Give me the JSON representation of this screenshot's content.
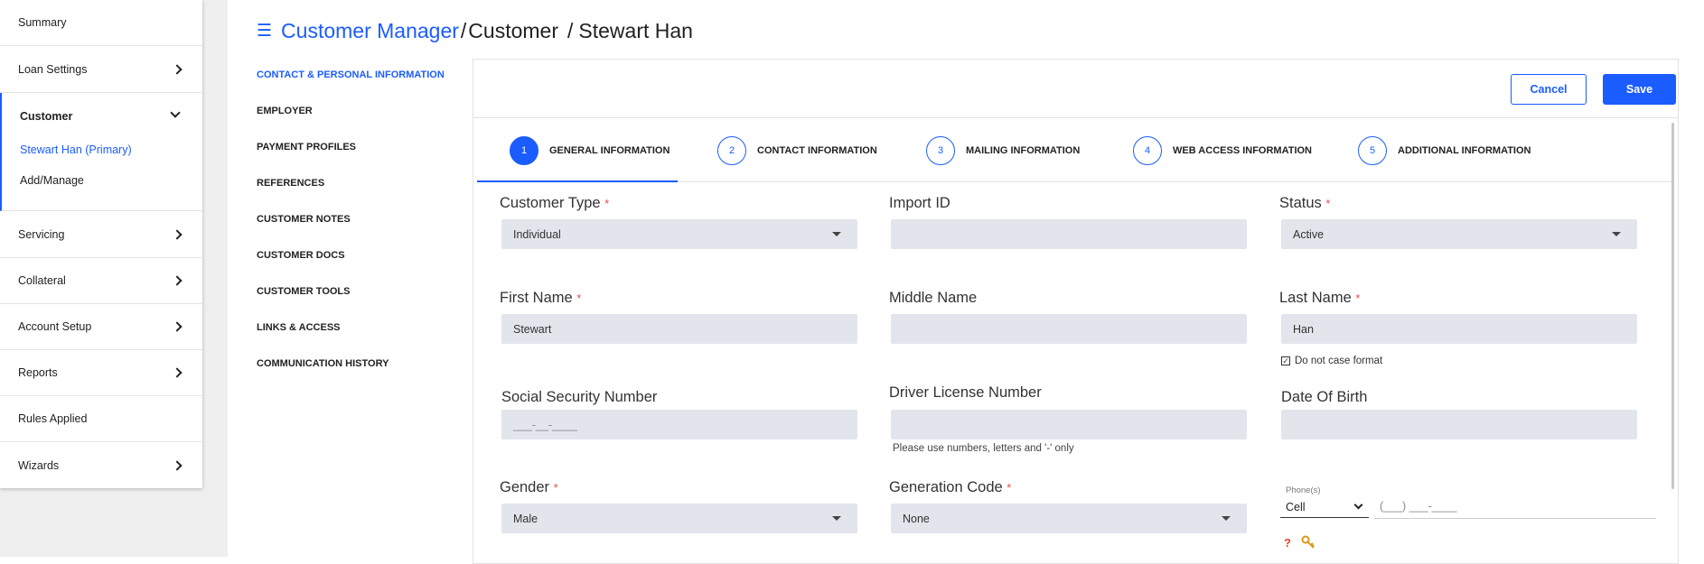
{
  "sidebar": {
    "items": {
      "summary": "Summary",
      "loan_settings": "Loan Settings",
      "customer": "Customer",
      "customer_primary": "Stewart Han (Primary)",
      "customer_add_manage": "Add/Manage",
      "servicing": "Servicing",
      "collateral": "Collateral",
      "account_setup": "Account Setup",
      "reports": "Reports",
      "rules_applied": "Rules Applied",
      "wizards": "Wizards"
    }
  },
  "header": {
    "menu_icon": "hamburger-icon",
    "breadcrumb_root": "Customer Manager",
    "separator": "/",
    "breadcrumb_mid": "Customer",
    "breadcrumb_current": "Stewart Han"
  },
  "subnav": [
    "CONTACT & PERSONAL INFORMATION",
    "EMPLOYER",
    "PAYMENT PROFILES",
    "REFERENCES",
    "CUSTOMER NOTES",
    "CUSTOMER DOCS",
    "CUSTOMER TOOLS",
    "LINKS & ACCESS",
    "COMMUNICATION HISTORY"
  ],
  "actions": {
    "cancel": "Cancel",
    "save": "Save"
  },
  "steps": [
    {
      "num": "1",
      "label": "GENERAL INFORMATION"
    },
    {
      "num": "2",
      "label": "CONTACT INFORMATION"
    },
    {
      "num": "3",
      "label": "MAILING INFORMATION"
    },
    {
      "num": "4",
      "label": "WEB ACCESS INFORMATION"
    },
    {
      "num": "5",
      "label": "ADDITIONAL INFORMATION"
    }
  ],
  "form": {
    "customer_type": {
      "label": "Customer Type",
      "value": "Individual"
    },
    "import_id": {
      "label": "Import ID",
      "value": ""
    },
    "status": {
      "label": "Status",
      "value": "Active"
    },
    "first_name": {
      "label": "First Name",
      "value": "Stewart"
    },
    "middle_name": {
      "label": "Middle Name",
      "value": ""
    },
    "last_name": {
      "label": "Last Name",
      "value": "Han"
    },
    "do_not_case_format": "Do not case format",
    "ssn": {
      "label": "Social Security Number",
      "placeholder": "___-__-____"
    },
    "driver_license": {
      "label": "Driver License Number",
      "value": "",
      "helper": "Please use numbers, letters and '-' only"
    },
    "dob": {
      "label": "Date Of Birth",
      "value": ""
    },
    "gender": {
      "label": "Gender",
      "value": "Male"
    },
    "generation_code": {
      "label": "Generation Code",
      "value": "None"
    },
    "phone": {
      "label": "Phone(s)",
      "type": "Cell",
      "placeholder": "(___) ___-____"
    },
    "required_mark": "*"
  },
  "colors": {
    "accent": "#1a5cff",
    "required": "#e05050",
    "input_bg": "#e2e5ec"
  }
}
